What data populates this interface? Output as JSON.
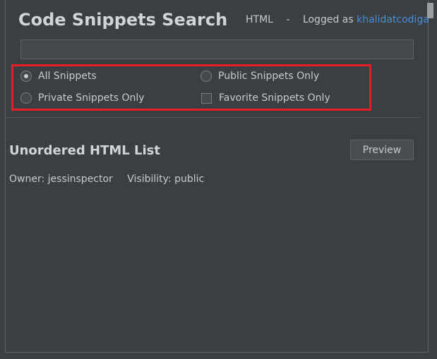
{
  "header": {
    "title": "Code Snippets Search",
    "language": "HTML",
    "separator": "-",
    "logged_as_label": "Logged as",
    "username": "khalidatcodiga"
  },
  "search": {
    "value": "",
    "placeholder": ""
  },
  "filters": {
    "all_snippets": "All Snippets",
    "public_only": "Public Snippets Only",
    "private_only": "Private Snippets Only",
    "favorite_only": "Favorite Snippets Only",
    "selected": "all_snippets"
  },
  "snippet": {
    "title": "Unordered HTML List",
    "preview_label": "Preview",
    "owner_label": "Owner:",
    "owner": "jessinspector",
    "visibility_label": "Visibility:",
    "visibility": "public"
  },
  "colors": {
    "background": "#3b3e42",
    "accent_link": "#4a8fd9",
    "highlight_border": "#e3202a"
  }
}
